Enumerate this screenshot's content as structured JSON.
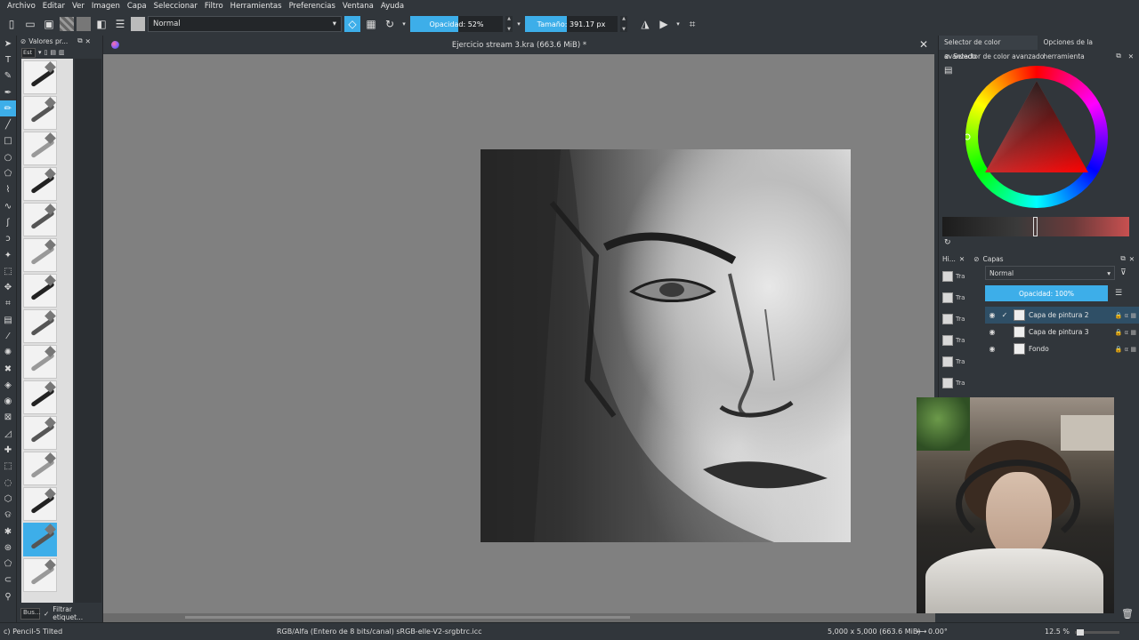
{
  "menubar": {
    "items": [
      "Archivo",
      "Editar",
      "Ver",
      "Imagen",
      "Capa",
      "Seleccionar",
      "Filtro",
      "Herramientas",
      "Preferencias",
      "Ventana",
      "Ayuda"
    ]
  },
  "toolbar": {
    "blend_mode": "Normal",
    "opacity_label": "Opacidad: 52%",
    "opacity_value": 0.52,
    "size_label": "Tamaño: 391.17 px",
    "size_fill": 0.45,
    "accent": "#3daee9"
  },
  "presets": {
    "title": "Valores pr...",
    "tag_value": "Est",
    "search_placeholder": "Bus...",
    "filter_label": "Filtrar etiquet...",
    "count": 15,
    "active_index": 13
  },
  "document": {
    "tab_title": "Ejercicio stream 3.kra (663.6 MiB) *"
  },
  "right": {
    "tabs": [
      "Selector de color avanzado",
      "Opciones de la herramienta"
    ],
    "color_title": "Selector de color avanzado",
    "layers_title": "Capas",
    "history_short": "Hi...",
    "history_items": [
      "Tra",
      "Tra",
      "Tra",
      "Tra",
      "Tra",
      "Tra",
      "Tra"
    ],
    "layer_blend": "Normal",
    "layer_opacity": "Opacidad: 100%",
    "layers": [
      {
        "name": "Capa de pintura 2",
        "selected": true
      },
      {
        "name": "Capa de pintura 3",
        "selected": false
      },
      {
        "name": "Fondo",
        "selected": false
      }
    ]
  },
  "status": {
    "brush": "c) Pencil-5 Tilted",
    "color_space": "RGB/Alfa (Entero de 8 bits/canal)  sRGB-elle-V2-srgbtrc.icc",
    "image_size": "5,000 x 5,000 (663.6 MiB)",
    "rotation": "0.00°",
    "zoom": "12.5 %"
  }
}
